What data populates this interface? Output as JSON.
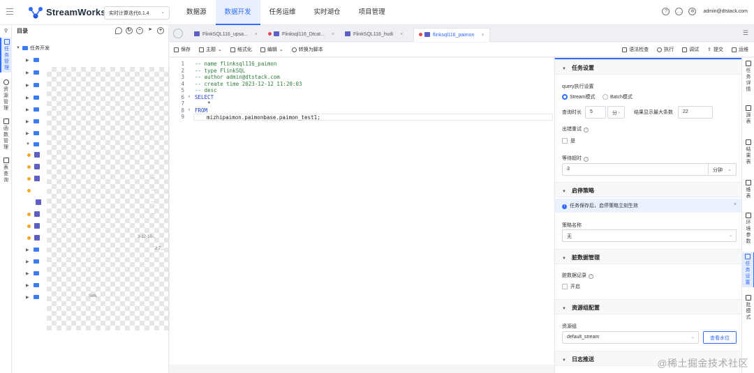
{
  "app": {
    "logo": "StreamWorks",
    "version_select": "实时计算迭代6.1.4",
    "user_email": "admin@dtstack.com"
  },
  "nav": [
    "数据源",
    "数据开发",
    "任务运维",
    "实时湖仓",
    "项目管理"
  ],
  "left_rail": [
    "任务管理",
    "资源管理",
    "函数管理",
    "表查询"
  ],
  "tree": {
    "title": "目录",
    "root": "任务开发",
    "fragments": [
      "...",
      "...",
      "...",
      "...",
      "3-12-10...",
      "2.7...",
      "Sols"
    ]
  },
  "tabs": [
    {
      "label": "FlinkSQL116_upsa...",
      "unsaved": false
    },
    {
      "label": "Flinksql116_Dtcat...",
      "unsaved": true
    },
    {
      "label": "FlinkSQL116_hudi",
      "unsaved": false
    },
    {
      "label": "flinksql116_paimon",
      "unsaved": true
    }
  ],
  "toolbar": {
    "left": [
      "保存",
      "主题",
      "格式化",
      "编辑",
      "转换为脚本"
    ],
    "right": [
      "语法检查",
      "执行",
      "调试",
      "提交",
      "运维"
    ]
  },
  "editor": {
    "lines": [
      {
        "n": "1",
        "text": "-- name flinksql116_paimon",
        "kind": "comment"
      },
      {
        "n": "2",
        "text": "-- type FlinkSQL",
        "kind": "comment"
      },
      {
        "n": "3",
        "text": "-- author admin@dtstack.com",
        "kind": "comment"
      },
      {
        "n": "4",
        "text": "-- create time 2023-12-12 11:20:03",
        "kind": "comment"
      },
      {
        "n": "5",
        "text": "-- desc",
        "kind": "comment"
      },
      {
        "n": "6",
        "text": "SELECT",
        "kind": "kw"
      },
      {
        "n": "7",
        "text": "    *",
        "kind": "txt"
      },
      {
        "n": "8",
        "text": "FROM",
        "kind": "kw"
      },
      {
        "n": "9",
        "text": "    mizhipaimon.paimonbase.paimon_test1;",
        "kind": "txt"
      }
    ]
  },
  "settings": {
    "task_settings": "任务设置",
    "query_settings": "query执行设置",
    "mode_stream": "Stream模式",
    "mode_batch": "Batch模式",
    "query_duration_label": "查询时长",
    "query_duration_value": "5",
    "query_duration_unit": "分",
    "max_rows_label": "结果显示最大条数",
    "max_rows_value": "22",
    "retry_label": "出错重试",
    "retry_option": "是",
    "wait_label": "等待超时",
    "wait_value": "3",
    "wait_unit": "分钟",
    "start_stop": "启停策略",
    "info_text": "任务保存后，启停策略立刻生效",
    "strategy_label": "策略名称",
    "strategy_value": "无",
    "dirty_data": "脏数据管理",
    "dirty_record_label": "脏数据记录",
    "dirty_record_option": "开启",
    "resource_group": "资源组配置",
    "resource_label": "资源组",
    "resource_value": "default_stream",
    "view_water_level": "查看水位",
    "log_push": "日志推送"
  },
  "right_rail": [
    "任务详情",
    "源表",
    "结果表",
    "维表",
    "环境参数",
    "任务设置",
    "批模式"
  ],
  "watermark": "@稀土掘金技术社区"
}
